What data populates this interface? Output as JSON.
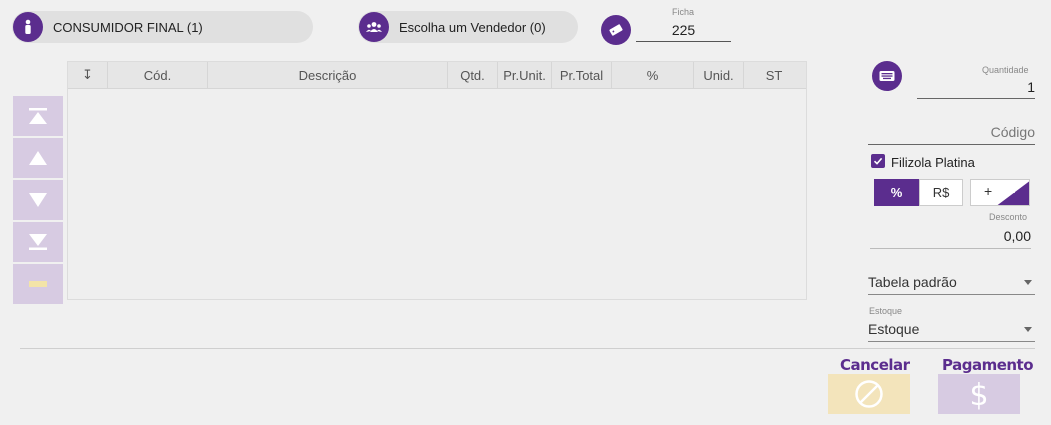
{
  "header": {
    "customer": {
      "label": "CONSUMIDOR FINAL (1)",
      "icon": "person-icon"
    },
    "seller": {
      "label": "Escolha um Vendedor (0)",
      "icon": "group-icon"
    },
    "ticket_icon": "ticket-icon",
    "ficha": {
      "label": "Ficha",
      "value": "225"
    }
  },
  "grid": {
    "columns": [
      "↧",
      "Cód.",
      "Descrição",
      "Qtd.",
      "Pr.Unit.",
      "Pr.Total",
      "%",
      "Unid.",
      "ST"
    ],
    "rows": []
  },
  "side_buttons": [
    "move-first",
    "move-up",
    "move-down",
    "move-last",
    "remove"
  ],
  "right_panel": {
    "keyboard_icon": "keyboard-icon",
    "quantidade": {
      "label": "Quantidade",
      "value": "1"
    },
    "codigo": {
      "placeholder": "Código"
    },
    "scale": {
      "label": "Filizola Platina",
      "checked": true
    },
    "discount_type": {
      "percent": "%",
      "currency": "R$",
      "selected": "%"
    },
    "discount_sign": {
      "plus": "+",
      "minus": "-"
    },
    "desconto": {
      "label": "Desconto",
      "value": "0,00"
    },
    "tabela": {
      "value": "Tabela padrão"
    },
    "estoque": {
      "label": "Estoque",
      "value": "Estoque"
    }
  },
  "actions": {
    "cancel": "Cancelar",
    "payment": "Pagamento"
  },
  "colors": {
    "accent": "#5b2d8e",
    "disabled_purple": "#d7cbe2",
    "cancel_bg": "#f3e4bb"
  }
}
